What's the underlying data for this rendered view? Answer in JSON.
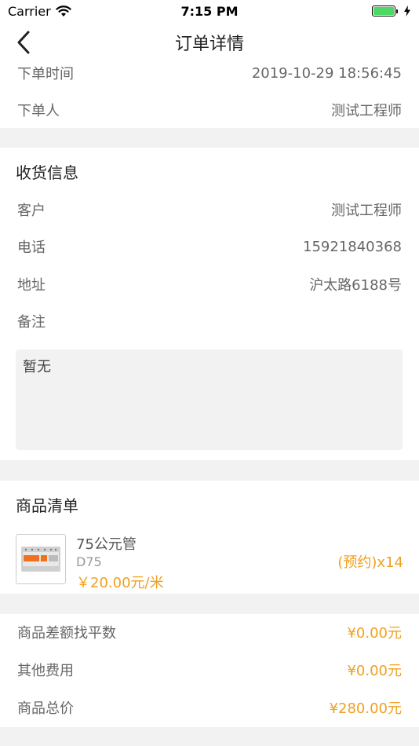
{
  "status_bar": {
    "carrier": "Carrier",
    "time": "7:15 PM"
  },
  "nav": {
    "title": "订单详情"
  },
  "order": {
    "time_label": "下单时间",
    "time_value": "2019-10-29 18:56:45",
    "user_label": "下单人",
    "user_value": "测试工程师"
  },
  "shipping": {
    "title": "收货信息",
    "customer_label": "客户",
    "customer_value": "测试工程师",
    "phone_label": "电话",
    "phone_value": "15921840368",
    "address_label": "地址",
    "address_value": "沪太路6188号",
    "remark_label": "备注",
    "remark_value": "暂无"
  },
  "products": {
    "title": "商品清单",
    "items": [
      {
        "name": "75公元管",
        "spec": "D75",
        "price": "￥20.00元/米",
        "quantity": "(预约)x14"
      }
    ]
  },
  "totals": {
    "diff_label": "商品差额找平数",
    "diff_value": "¥0.00元",
    "other_label": "其他费用",
    "other_value": "¥0.00元",
    "total_label": "商品总价",
    "total_value": "¥280.00元"
  },
  "colors": {
    "accent": "#f0a020",
    "battery": "#4cd964",
    "background": "#f2f2f2"
  },
  "icons": [
    "wifi-icon",
    "battery-icon",
    "charging-icon",
    "back-chevron-icon"
  ]
}
